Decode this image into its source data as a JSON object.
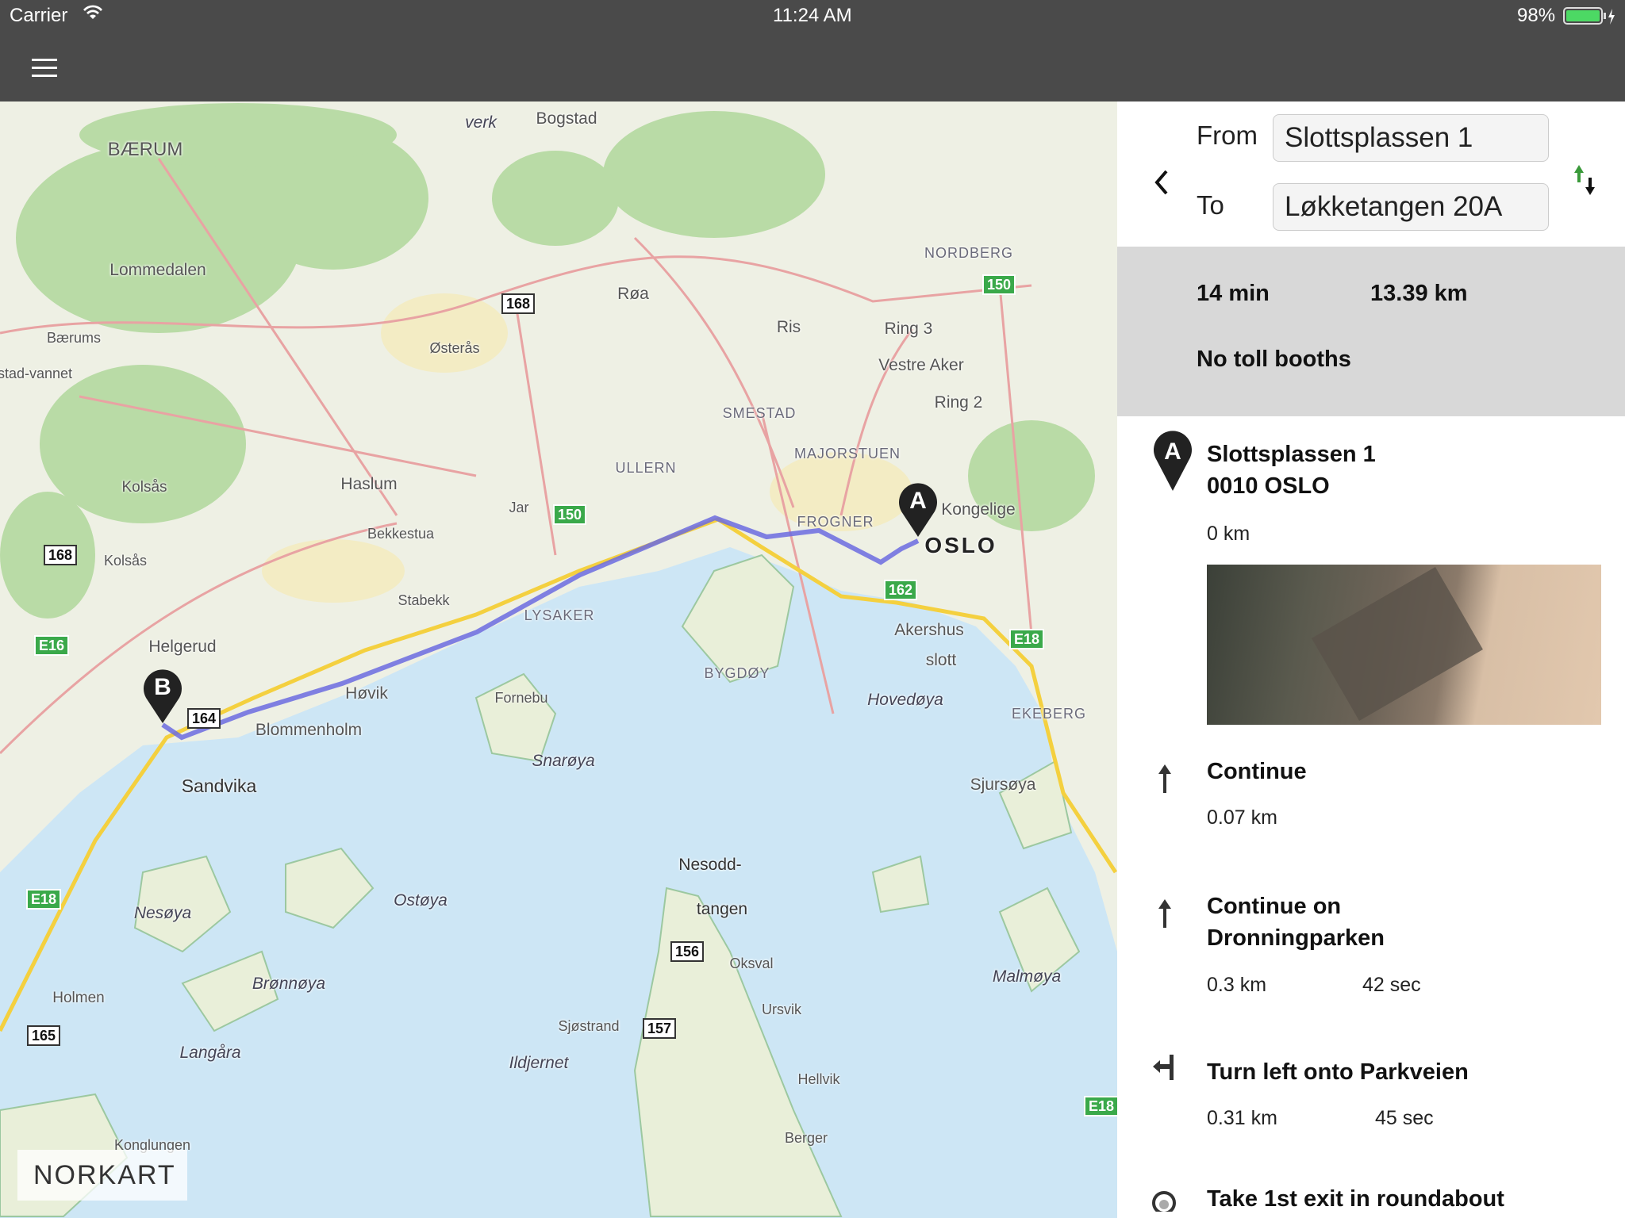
{
  "status_bar": {
    "carrier": "Carrier",
    "time": "11:24 AM",
    "battery": "98%"
  },
  "navbar": {
    "menu_icon": "hamburger-icon"
  },
  "route_form": {
    "from_label": "From",
    "from_value": "Slottsplassen 1",
    "to_label": "To",
    "to_value": "Løkketangen 20A",
    "back_icon": "chevron-left-icon",
    "swap_icon": "swap-arrows-icon"
  },
  "summary": {
    "duration": "14 min",
    "distance": "13.39 km",
    "toll": "No toll booths"
  },
  "start": {
    "marker": "A",
    "name": "Slottsplassen 1",
    "postal": "0010 OSLO",
    "distance": "0 km"
  },
  "steps": [
    {
      "icon": "arrow-up-icon",
      "title": "Continue",
      "distance": "0.07 km",
      "time": ""
    },
    {
      "icon": "arrow-up-icon",
      "title": "Continue on Dronningparken",
      "distance": "0.3 km",
      "time": "42 sec"
    },
    {
      "icon": "turn-left-icon",
      "title": "Turn left onto Parkveien",
      "distance": "0.31 km",
      "time": "45 sec"
    },
    {
      "icon": "roundabout-icon",
      "title": "Take 1st exit in roundabout",
      "distance": "",
      "time": ""
    }
  ],
  "map": {
    "colors": {
      "water": "#cde6f5",
      "land": "#eef0e4",
      "forest": "#b9dba6",
      "route": "#6b6be0",
      "major_road": "#f4d03f",
      "road": "#e8a3a3"
    },
    "markers": {
      "a": "A",
      "b": "B"
    },
    "logo": "NORKART",
    "labels": [
      "BÆRUM",
      "Bogstad",
      "Lommedalen",
      "Bærums",
      "Østerås",
      "Røa",
      "Ris",
      "Ring 3",
      "Vestre Aker",
      "NORDBERG",
      "Ring 2",
      "SMESTAD",
      "MAJORSTUEN",
      "ULLERN",
      "Haslum",
      "Kolsås",
      "Kolsås",
      "Jar",
      "Bekkestua",
      "FROGNER",
      "Kongelige",
      "OSLO",
      "Stabekk",
      "LYSAKER",
      "Helgerud",
      "Akershus",
      "slott",
      "Høvik",
      "BYGDØY",
      "Fornebu",
      "Blommenholm",
      "Hovedøya",
      "EKEBERG",
      "Sandvika",
      "Snarøya",
      "Sjursøya",
      "Nesodd-",
      "tangen",
      "Nesøya",
      "Ostøya",
      "Brønnøya",
      "Malmøya",
      "Oksval",
      "Holmen",
      "Ursvik",
      "Sjøstrand",
      "Langåra",
      "Ildjernet",
      "Hellvik",
      "Berger",
      "Konglungen",
      "Bogstad-vannet",
      "verk"
    ],
    "shields": [
      "168",
      "150",
      "150",
      "162",
      "E18",
      "168",
      "E16",
      "164",
      "E18",
      "156",
      "157",
      "165",
      "E18"
    ]
  }
}
